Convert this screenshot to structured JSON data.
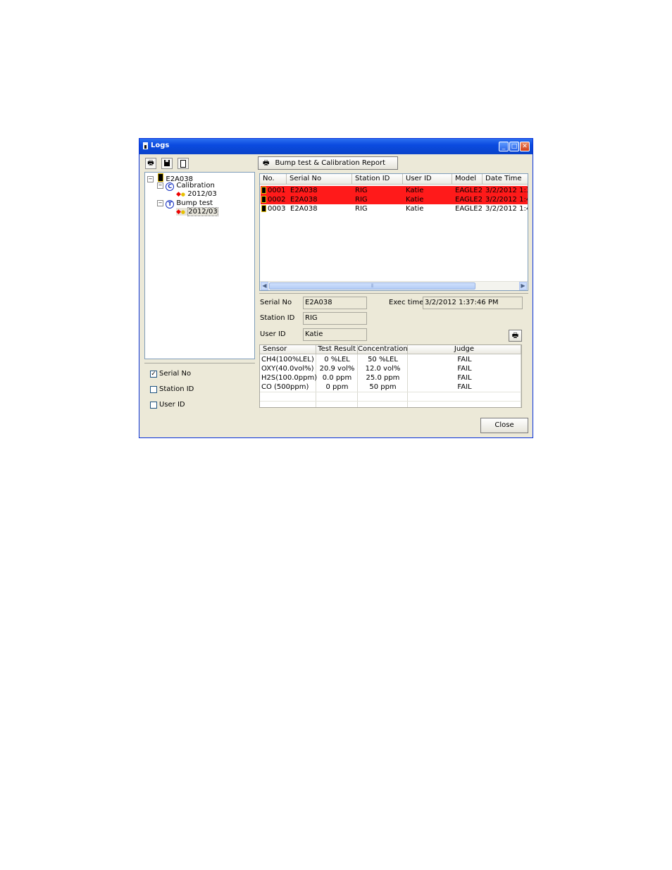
{
  "window": {
    "title": "Logs"
  },
  "toolbar": {
    "print_icon": "printer-icon",
    "save_icon": "floppy-disk-icon",
    "copy_icon": "clipboard-icon"
  },
  "tree": {
    "root": "E2A038",
    "items": [
      {
        "label": "Calibration",
        "badge": "C",
        "child": "2012/03"
      },
      {
        "label": "Bump test",
        "badge": "T",
        "child": "2012/03"
      }
    ]
  },
  "filters": [
    {
      "label": "Serial No",
      "checked": true,
      "mark": "✓"
    },
    {
      "label": "Station ID",
      "checked": false,
      "mark": ""
    },
    {
      "label": "User ID",
      "checked": false,
      "mark": ""
    }
  ],
  "report_button": "Bump test & Calibration Report",
  "list": {
    "columns": [
      "No.",
      "Serial No",
      "Station ID",
      "User ID",
      "Model",
      "Date Time"
    ],
    "rows": [
      {
        "no": "0001",
        "serial": "E2A038",
        "station": "RIG",
        "user": "Katie",
        "model": "EAGLE2",
        "datetime": "3/2/2012 1:3",
        "highlight": true
      },
      {
        "no": "0002",
        "serial": "E2A038",
        "station": "RIG",
        "user": "Katie",
        "model": "EAGLE2",
        "datetime": "3/2/2012 1:4",
        "highlight": true
      },
      {
        "no": "0003",
        "serial": "E2A038",
        "station": "RIG",
        "user": "Katie",
        "model": "EAGLE2",
        "datetime": "3/2/2012 1:4",
        "highlight": false
      }
    ],
    "scroll_grip": "⦀"
  },
  "detail": {
    "serial_label": "Serial No",
    "serial_value": "E2A038",
    "station_label": "Station ID",
    "station_value": "RIG",
    "user_label": "User ID",
    "user_value": "Katie",
    "exec_label": "Exec time",
    "exec_value": "3/2/2012 1:37:46 PM"
  },
  "sensors": {
    "columns": [
      "Sensor",
      "Test Result",
      "Concentration",
      "Judge"
    ],
    "rows": [
      {
        "sensor": "CH4(100%LEL)",
        "result": "0 %LEL",
        "conc": "50 %LEL",
        "judge": "FAIL"
      },
      {
        "sensor": "OXY(40.0vol%)",
        "result": "20.9 vol%",
        "conc": "12.0 vol%",
        "judge": "FAIL"
      },
      {
        "sensor": "H2S(100.0ppm)",
        "result": "0.0 ppm",
        "conc": "25.0 ppm",
        "judge": "FAIL"
      },
      {
        "sensor": "CO (500ppm)",
        "result": "0 ppm",
        "conc": "50 ppm",
        "judge": "FAIL"
      }
    ]
  },
  "close_button": "Close",
  "colors": {
    "highlight": "#ff1a1a",
    "titlebar": "#0b4be0",
    "face": "#ece9d8"
  }
}
